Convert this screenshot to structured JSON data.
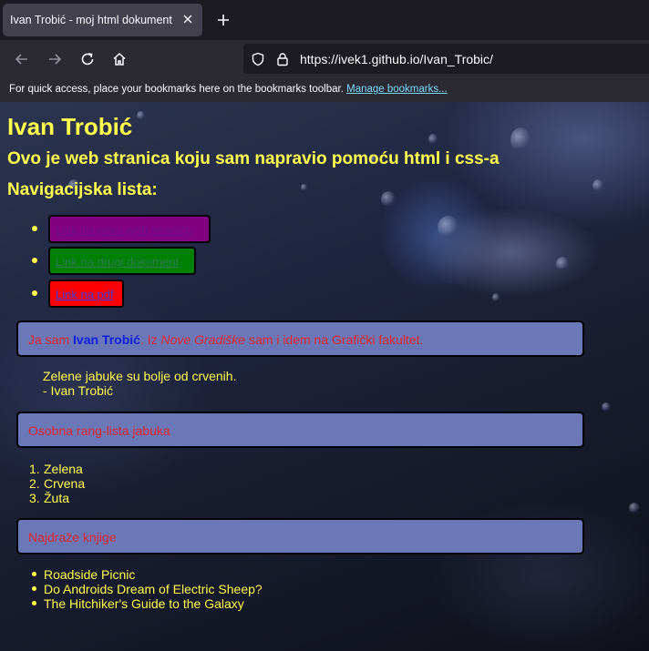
{
  "browser": {
    "tab_title": "Ivan Trobić - moj html dokument",
    "url": "https://ivek1.github.io/Ivan_Trobic/",
    "bookmarks_message": "For quick access, place your bookmarks here on the bookmarks toolbar.",
    "bookmarks_link": "Manage bookmarks..."
  },
  "page": {
    "heading": "Ivan Trobić",
    "subheading": "Ovo je web stranica koju sam napravio pomoću html i css-a",
    "nav_heading": "Navigacijska lista:",
    "nav_links": [
      {
        "label": "Link na neku web stranicu",
        "bg": "#800080",
        "color": "#6e0d8a"
      },
      {
        "label": "Link na drugi dokument",
        "bg": "#008000",
        "color": "#2d7a55"
      },
      {
        "label": "Link na pdf",
        "bg": "#ff0000",
        "color": "#3a3ad8"
      }
    ],
    "intro": {
      "prefix": "Ja sam",
      "name": "Ivan Trobić",
      "mid": ". Iz",
      "town": "Nove Gradiške",
      "suffix": "sam i idem na Grafički fakultet."
    },
    "quote_line1": "Zelene jabuke su bolje od crvenih.",
    "quote_line2": "- Ivan Trobić",
    "ranking_title": "Osobna rang-lista jabuka",
    "ranking": [
      {
        "num": "1.",
        "text": "Zelena"
      },
      {
        "num": "2.",
        "text": "Crvena"
      },
      {
        "num": "3.",
        "text": "Žuta"
      }
    ],
    "books_title": "Najdraže knjige",
    "books": [
      "Roadside Picnic",
      "Do Androids Dream of Electric Sheep?",
      "The Hitchiker's Guide to the Galaxy"
    ]
  },
  "colors": {
    "heading_text": "#ffff4d",
    "panel_bg": "#6b78b8",
    "panel_text": "#e8242a",
    "name_text": "#1020e0"
  }
}
